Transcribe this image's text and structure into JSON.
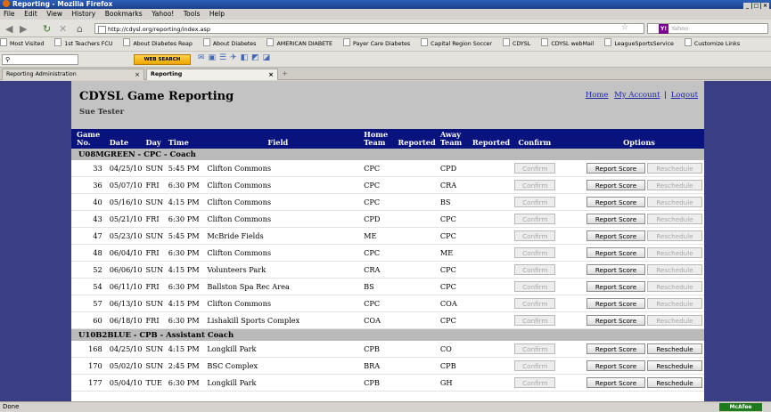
{
  "window": {
    "title": "Reporting - Mozilla Firefox"
  },
  "menu": [
    "File",
    "Edit",
    "View",
    "History",
    "Bookmarks",
    "Yahoo!",
    "Tools",
    "Help"
  ],
  "nav": {
    "url": "http://cdysl.org/reporting/index.asp",
    "search_placeholder": "Yahoo",
    "search_brand": "Y!"
  },
  "bookmarks": [
    "Most Visited",
    "1st Teachers FCU",
    "About Diabetes Reap",
    "About Diabetes",
    "AMERICAN DIABETE",
    "Payer Care Diabetes",
    "Capital Region Soccer",
    "CDYSL",
    "CDYSL webMail",
    "LeagueSportsService",
    "Customize Links"
  ],
  "toolbar2": {
    "web_search": "WEB SEARCH"
  },
  "tabs": [
    {
      "label": "Reporting Administration"
    },
    {
      "label": "Reporting"
    }
  ],
  "page": {
    "title": "CDYSL Game Reporting",
    "user": "Sue Tester",
    "links": {
      "home": "Home",
      "account": "My Account",
      "logout": "Logout"
    }
  },
  "columns": {
    "game_no": "Game No.",
    "date": "Date",
    "day": "Day",
    "time": "Time",
    "field": "Field",
    "home_team": "Home Team",
    "reported": "Reported",
    "away_team": "Away Team",
    "reported2": "Reported",
    "confirm": "Confirm",
    "options": "Options"
  },
  "buttons": {
    "confirm": "Confirm",
    "report": "Report Score",
    "reschedule": "Reschedule"
  },
  "groups": [
    {
      "name": "U08MGREEN - CPC - Coach",
      "games": [
        {
          "no": "33",
          "date": "04/25/10",
          "day": "SUN",
          "time": "5:45 PM",
          "field": "Clifton Commons",
          "home": "CPC",
          "away": "CPD",
          "resched_enabled": false
        },
        {
          "no": "36",
          "date": "05/07/10",
          "day": "FRI",
          "time": "6:30 PM",
          "field": "Clifton Commons",
          "home": "CPC",
          "away": "CRA",
          "resched_enabled": false
        },
        {
          "no": "40",
          "date": "05/16/10",
          "day": "SUN",
          "time": "4:15 PM",
          "field": "Clifton Commons",
          "home": "CPC",
          "away": "BS",
          "resched_enabled": false
        },
        {
          "no": "43",
          "date": "05/21/10",
          "day": "FRI",
          "time": "6:30 PM",
          "field": "Clifton Commons",
          "home": "CPD",
          "away": "CPC",
          "resched_enabled": false
        },
        {
          "no": "47",
          "date": "05/23/10",
          "day": "SUN",
          "time": "5:45 PM",
          "field": "McBride Fields",
          "home": "ME",
          "away": "CPC",
          "resched_enabled": false
        },
        {
          "no": "48",
          "date": "06/04/10",
          "day": "FRI",
          "time": "6:30 PM",
          "field": "Clifton Commons",
          "home": "CPC",
          "away": "ME",
          "resched_enabled": false
        },
        {
          "no": "52",
          "date": "06/06/10",
          "day": "SUN",
          "time": "4:15 PM",
          "field": "Volunteers Park",
          "home": "CRA",
          "away": "CPC",
          "resched_enabled": false
        },
        {
          "no": "54",
          "date": "06/11/10",
          "day": "FRI",
          "time": "6:30 PM",
          "field": "Ballston Spa Rec Area",
          "home": "BS",
          "away": "CPC",
          "resched_enabled": false
        },
        {
          "no": "57",
          "date": "06/13/10",
          "day": "SUN",
          "time": "4:15 PM",
          "field": "Clifton Commons",
          "home": "CPC",
          "away": "COA",
          "resched_enabled": false
        },
        {
          "no": "60",
          "date": "06/18/10",
          "day": "FRI",
          "time": "6:30 PM",
          "field": "Lishakill Sports Complex",
          "home": "COA",
          "away": "CPC",
          "resched_enabled": false
        }
      ]
    },
    {
      "name": "U10B2BLUE - CPB - Assistant Coach",
      "games": [
        {
          "no": "168",
          "date": "04/25/10",
          "day": "SUN",
          "time": "4:15 PM",
          "field": "Longkill Park",
          "home": "CPB",
          "away": "CO",
          "resched_enabled": true
        },
        {
          "no": "170",
          "date": "05/02/10",
          "day": "SUN",
          "time": "2:45 PM",
          "field": "BSC Complex",
          "home": "BRA",
          "away": "CPB",
          "resched_enabled": true
        },
        {
          "no": "177",
          "date": "05/04/10",
          "day": "TUE",
          "time": "6:30 PM",
          "field": "Longkill Park",
          "home": "CPB",
          "away": "GH",
          "resched_enabled": true
        }
      ]
    }
  ],
  "status": {
    "text": "Done",
    "mcafee": "McAfee"
  }
}
